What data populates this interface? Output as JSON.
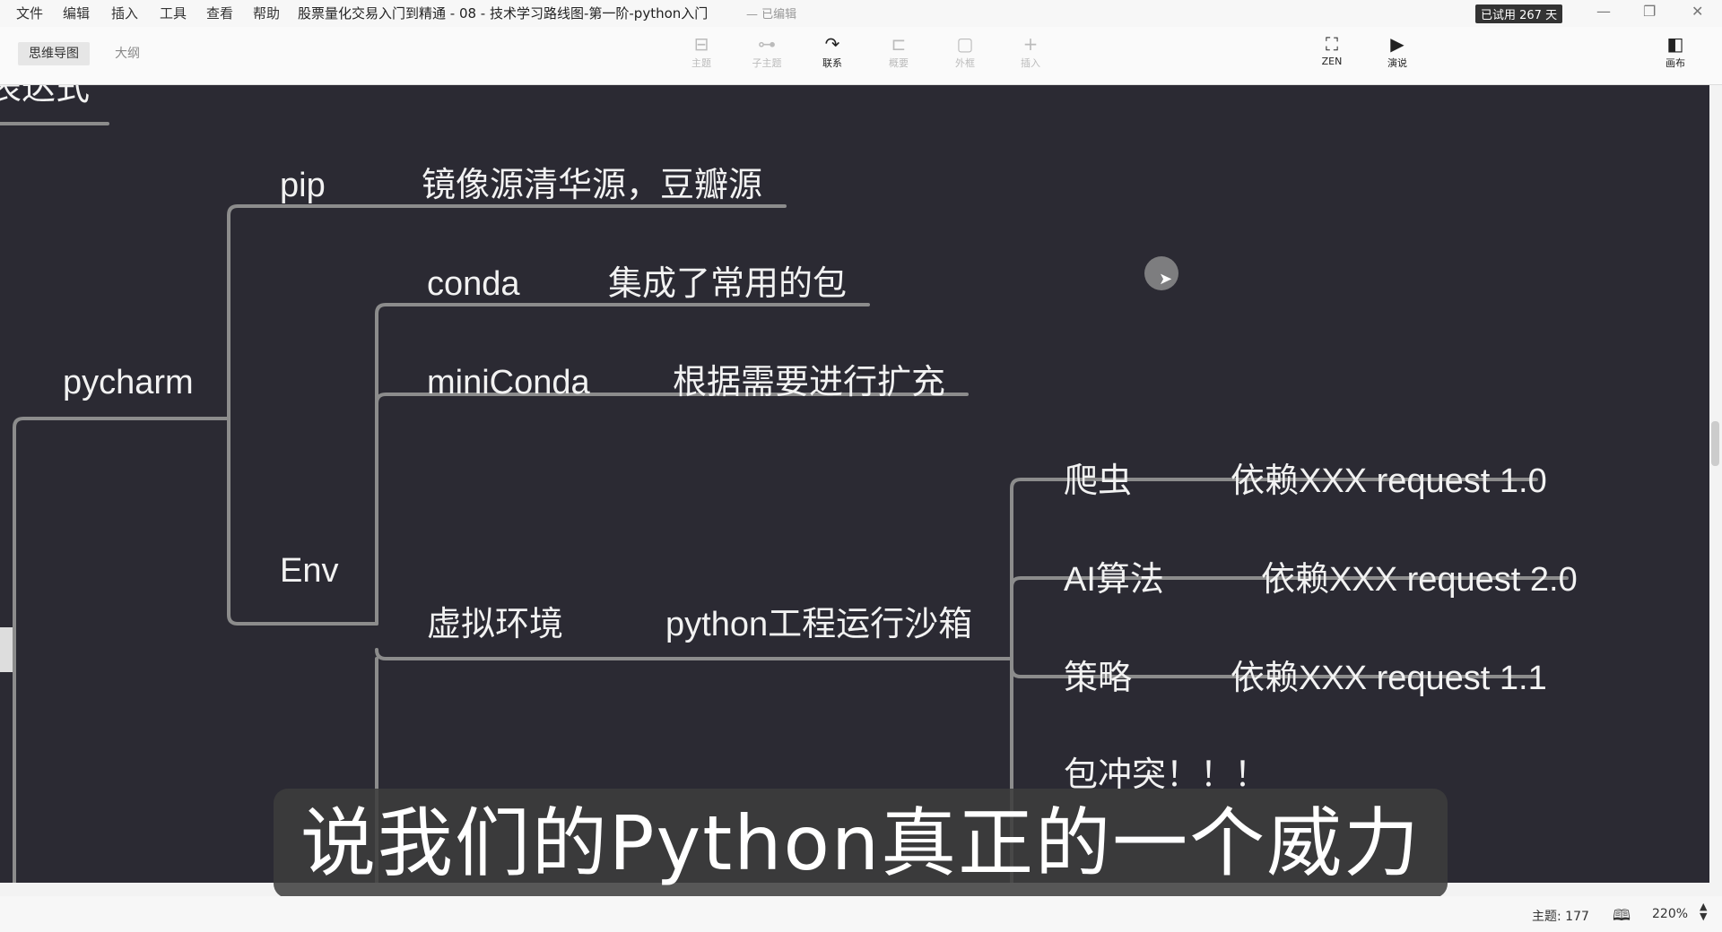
{
  "menu": [
    "文件",
    "编辑",
    "插入",
    "工具",
    "查看",
    "帮助"
  ],
  "window": {
    "title": "股票量化交易入门到精通 - 08 - 技术学习路线图-第一阶-python入门",
    "status": "— 已编辑",
    "trial_badge": "已试用 267 天"
  },
  "view_tabs": {
    "mindmap": "思维导图",
    "outline": "大纲"
  },
  "toolbar": {
    "topic": "主题",
    "subtopic": "子主题",
    "relation": "联系",
    "summary": "概要",
    "boundary": "外框",
    "insert": "插入",
    "zen": "ZEN",
    "present": "演说",
    "format": "画布"
  },
  "mindmap": {
    "root_fragment": "表达式",
    "pycharm": "pycharm",
    "pip": "pip",
    "pip_note": "镜像源清华源，豆瓣源",
    "env": "Env",
    "conda": "conda",
    "conda_note": "集成了常用的包",
    "miniconda": "miniConda",
    "miniconda_note": "根据需要进行扩充",
    "venv": "虚拟环境",
    "venv_note": "python工程运行沙箱",
    "crawler": "爬虫",
    "crawler_dep": "依赖XXX request 1.0",
    "ai": "AI算法",
    "ai_dep": "依赖XXX request 2.0",
    "strategy": "策略",
    "strategy_dep": "依赖XXX request 1.1",
    "conflict": "包冲突！！！"
  },
  "subtitle": "说我们的Python真正的一个威力",
  "statusbar": {
    "topic_count": "主题: 177",
    "zoom": "220%"
  },
  "colors": {
    "canvas_bg": "#2b2a33",
    "branch_line": "#8c8c8c",
    "node_text": "#f2f2f2"
  }
}
